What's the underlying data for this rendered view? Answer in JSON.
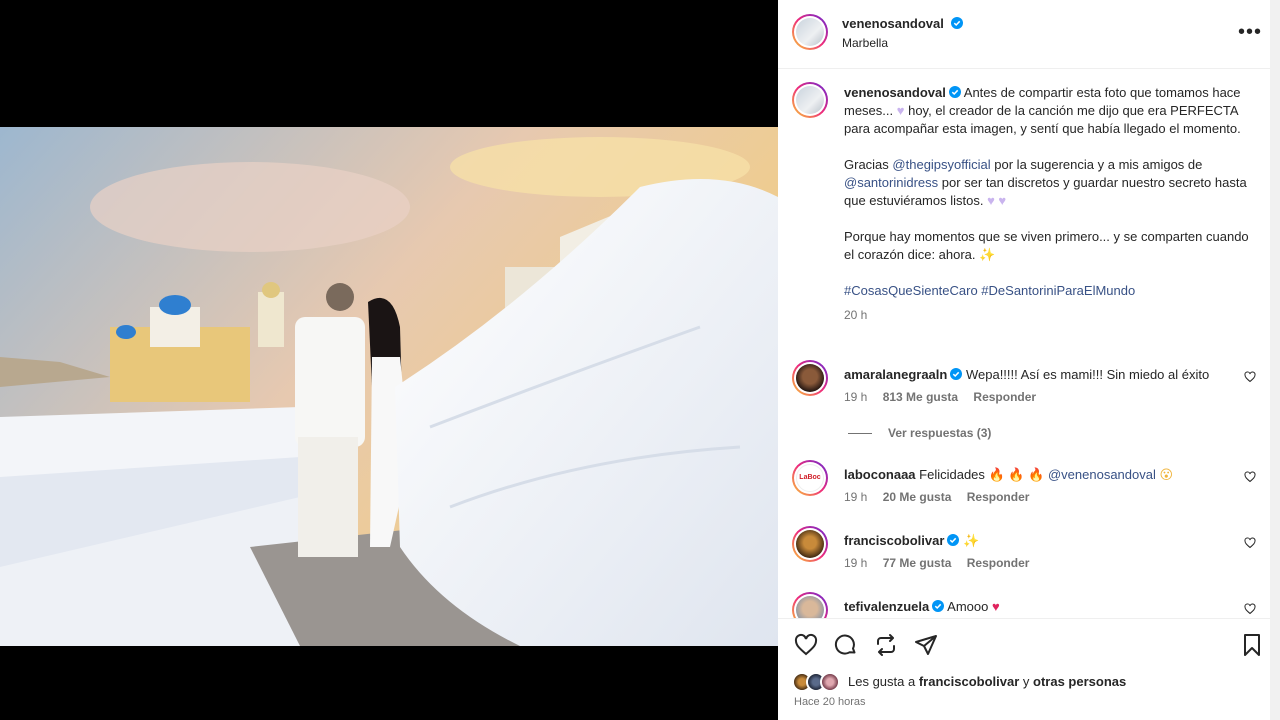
{
  "header": {
    "username": "venenosandoval",
    "location": "Marbella",
    "more_icon": "more-horizontal-icon"
  },
  "caption": {
    "username": "venenosandoval",
    "p1_a": "Antes de compartir esta foto que tomamos hace meses...",
    "p1_b": "hoy, el creador de la canción me dijo que era PERFECTA para acompañar esta imagen, y sentí que había llegado el momento.",
    "p2_a": "Gracias",
    "p2_mention1": "@thegipsyofficial",
    "p2_b": "por la sugerencia y a mis amigos de",
    "p2_mention2": "@santorinidress",
    "p2_c": "por ser tan discretos y guardar nuestro secreto hasta que estuviéramos listos.",
    "p3": "Porque hay momentos que se viven primero... y se comparten cuando el corazón dice: ahora.",
    "hashtags": "#CosasQueSienteCaro #DeSantoriniParaElMundo",
    "time": "20 h"
  },
  "comments": [
    {
      "user": "amaralanegraaln",
      "text": "Wepa!!!!! Así es mami!!! Sin miedo al éxito",
      "time": "19 h",
      "likes": "813 Me gusta",
      "reply": "Responder",
      "verified": true
    },
    {
      "user": "laboconaaa",
      "text": "Felicidades",
      "mention": "@venenosandoval",
      "time": "19 h",
      "likes": "20 Me gusta",
      "reply": "Responder",
      "verified": false
    },
    {
      "user": "franciscobolivar",
      "text": "",
      "time": "19 h",
      "likes": "77 Me gusta",
      "reply": "Responder",
      "verified": true
    },
    {
      "user": "tefivalenzuela",
      "text": "Amooo",
      "verified": true
    }
  ],
  "view_replies": "Ver respuestas (3)",
  "likes": {
    "prefix": "Les gusta a",
    "user": "franciscobolivar",
    "middle": "y",
    "others": "otras personas"
  },
  "post_time": "Hace 20 horas",
  "colors": {
    "link": "#385185",
    "verified": "#0095f6",
    "muted": "#737373"
  }
}
